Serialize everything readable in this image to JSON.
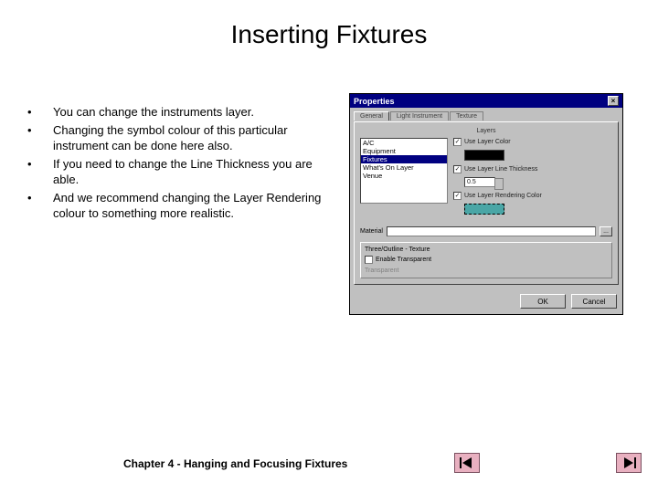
{
  "title": "Inserting Fixtures",
  "bullets": [
    "You can change the instruments layer.",
    "Changing the symbol colour of this particular instrument can be done here also.",
    "If you need to change the Line Thickness you are able.",
    "And we recommend changing the Layer Rendering colour to something more realistic."
  ],
  "dialog": {
    "title": "Properties",
    "tabs": [
      "General",
      "Light Instrument",
      "Texture"
    ],
    "caption": "Layers",
    "list": [
      "A/C",
      "Equipment",
      "Fixtures",
      "What's On Layer",
      "Venue"
    ],
    "selected_index": 2,
    "options": {
      "use_layer_color": "Use Layer Color",
      "use_layer_thickness": "Use Layer Line Thickness",
      "thickness_value": "0.5",
      "use_layer_rendering": "Use Layer Rendering Color"
    },
    "material_label": "Material",
    "material_btn": "...",
    "group_header": "Three/Outline - Texture",
    "group_check": "Enable Transparent",
    "group_sub": "Transparent",
    "ok": "OK",
    "cancel": "Cancel"
  },
  "footer": "Chapter 4 - Hanging and Focusing Fixtures",
  "bullet_char": "•"
}
